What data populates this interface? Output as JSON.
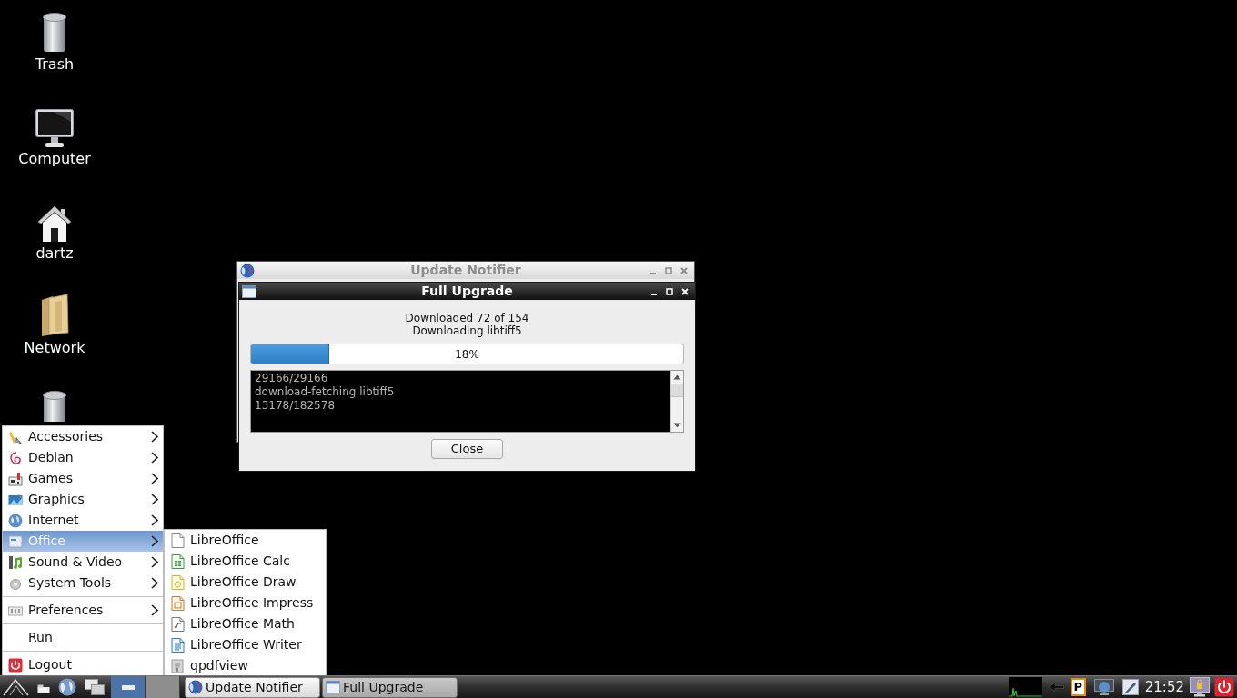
{
  "desktop_icons": [
    {
      "label": "Trash"
    },
    {
      "label": "Computer"
    },
    {
      "label": "dartz"
    },
    {
      "label": "Network"
    }
  ],
  "windows": [
    {
      "title": "Update Notifier",
      "active": false
    },
    {
      "title": "Full Upgrade",
      "active": true
    }
  ],
  "dialog": {
    "status_lines": [
      "Downloaded 72 of 154",
      "Downloading libtiff5"
    ],
    "progress": {
      "level": 0.18,
      "label": "18%"
    },
    "log_lines": [
      "29166/29166",
      "download-fetching libtiff5",
      "13178/182578"
    ],
    "close_button": "Close"
  },
  "start_menu": {
    "groups": [
      {
        "items": [
          {
            "label": "Accessories",
            "kind": "submenu",
            "selected": false
          },
          {
            "label": "Debian",
            "kind": "submenu",
            "selected": false
          },
          {
            "label": "Games",
            "kind": "submenu",
            "selected": false
          },
          {
            "label": "Graphics",
            "kind": "submenu",
            "selected": false
          },
          {
            "label": "Internet",
            "kind": "submenu",
            "selected": false
          },
          {
            "label": "Office",
            "kind": "submenu",
            "selected": true
          },
          {
            "label": "Sound & Video",
            "kind": "submenu",
            "selected": false
          },
          {
            "label": "System Tools",
            "kind": "submenu",
            "selected": false
          }
        ]
      },
      {
        "items": [
          {
            "label": "Preferences",
            "kind": "submenu",
            "selected": false
          }
        ]
      },
      {
        "items": [
          {
            "label": "Run",
            "kind": "action",
            "selected": false
          }
        ]
      },
      {
        "items": [
          {
            "label": "Logout",
            "kind": "action",
            "selected": false
          }
        ]
      }
    ]
  },
  "office_submenu": {
    "items": [
      {
        "label": "LibreOffice",
        "selected": false
      },
      {
        "label": "LibreOffice Calc",
        "selected": false
      },
      {
        "label": "LibreOffice Draw",
        "selected": false
      },
      {
        "label": "LibreOffice Impress",
        "selected": false
      },
      {
        "label": "LibreOffice Math",
        "selected": false
      },
      {
        "label": "LibreOffice Writer",
        "selected": false
      },
      {
        "label": "qpdfview",
        "selected": false
      }
    ]
  },
  "taskbar": {
    "workspaces": [
      {
        "selected": true
      },
      {
        "selected": false
      }
    ],
    "tasks": [
      {
        "label": "Update Notifier",
        "selected": false
      },
      {
        "label": "Full Upgrade",
        "selected": true
      }
    ],
    "tray_badge": "P",
    "clock": "21:52"
  }
}
